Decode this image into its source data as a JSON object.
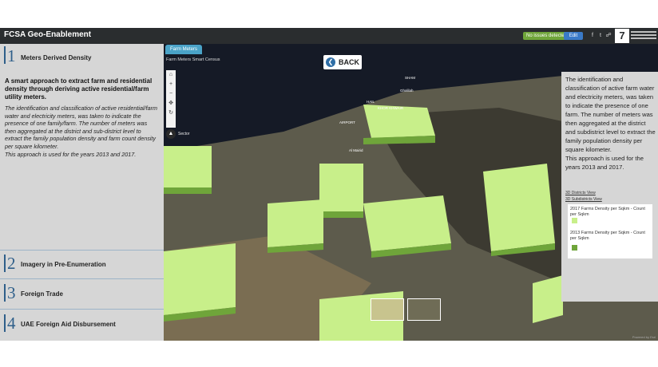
{
  "header": {
    "title": "FCSA Geo-Enablement",
    "issues_badge": "No issues detected",
    "edit_label": "Edit",
    "share_icons": [
      "facebook-icon",
      "twitter-icon",
      "link-icon"
    ],
    "logo_glyph": "7"
  },
  "left_panel": {
    "sections": [
      {
        "number": "1",
        "label": "Meters Derived Density",
        "active": true
      },
      {
        "number": "2",
        "label": "Imagery in Pre-Enumeration"
      },
      {
        "number": "3",
        "label": "Foreign Trade"
      },
      {
        "number": "4",
        "label": "UAE Foreign Aid Disbursement"
      }
    ],
    "description_strong": "A smart approach to extract farm and residential density through deriving active residential/farm utility meters.",
    "description_p1": "The identification and classification of active residential/farm water and electricity meters, was taken to indicate the presence of one family/farm. The number of meters was then aggregated at the district and sub-district level to extract the family population density and farm count density per square kilometer.",
    "description_p2": "This approach is used for the years 2013 and 2017."
  },
  "map": {
    "tab_label": "Farm Meters",
    "caption": "Farm Meters Smart Census",
    "back_label": "BACK",
    "sector_label": "Sector",
    "footer": "Powered by Esri",
    "tools": [
      "home-icon",
      "zoom-in-icon",
      "zoom-out-icon",
      "compass-icon",
      "rotate-icon"
    ],
    "places": [
      "SHAM",
      "Ghalilah",
      "AIRPORT",
      "HAIL",
      "KHOR KHWAIR",
      "Al Mairid"
    ]
  },
  "right_panel": {
    "desc_p1": "The identification and classification of active farm water and electricity meters, was taken to indicate the presence of one farm. The number of meters was then aggregated at the district and subdistrict level to extract the family population density per square kilometer.",
    "desc_p2": "This approach is used for the years 2013 and 2017.",
    "link_districts": "3D Districts View",
    "link_subdistricts": "3D Subdistricts View",
    "legend": [
      {
        "title": "2017 Farms Density per Sqkm - Count per Sqkm",
        "color": "#c8ef8a"
      },
      {
        "title": "2013 Farms Density per Sqkm - Count per Sqkm",
        "color": "#6fa53a"
      }
    ]
  }
}
